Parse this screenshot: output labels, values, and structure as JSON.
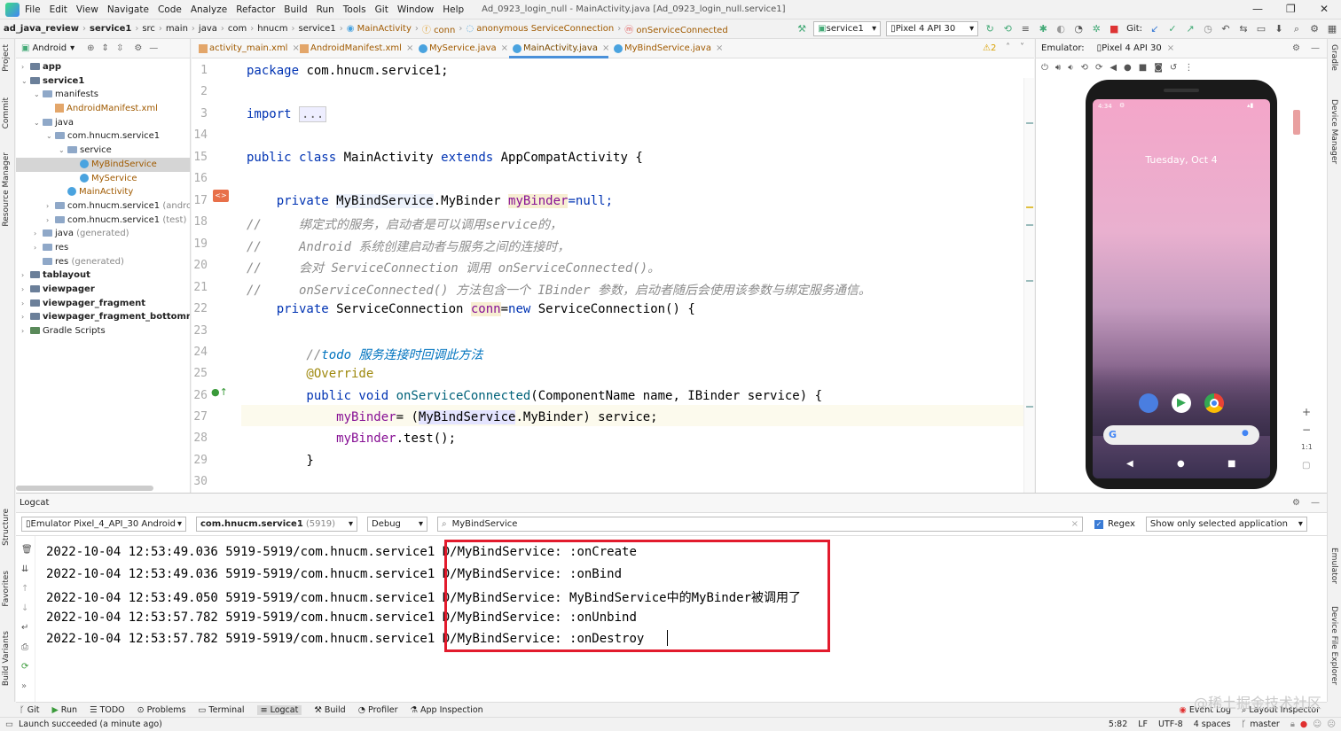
{
  "menubar": {
    "items": [
      "File",
      "Edit",
      "View",
      "Navigate",
      "Code",
      "Analyze",
      "Refactor",
      "Build",
      "Run",
      "Tools",
      "Git",
      "Window",
      "Help"
    ],
    "window_title": "Ad_0923_login_null - MainActivity.java [Ad_0923_login_null.service1]"
  },
  "navbar": {
    "crumbs": [
      "ad_java_review",
      "service1",
      "src",
      "main",
      "java",
      "com",
      "hnucm",
      "service1",
      "MainActivity",
      "conn",
      "anonymous ServiceConnection",
      "onServiceConnected"
    ],
    "run_config": "service1",
    "device": "Pixel 4 API 30",
    "git_label": "Git:"
  },
  "left_tools": [
    "Project",
    "Commit",
    "Resource Manager",
    "Structure",
    "Favorites",
    "Build Variants"
  ],
  "right_tools": [
    "Gradle",
    "Device Manager",
    "Emulator",
    "Device File Explorer"
  ],
  "project": {
    "view": "Android",
    "tree": [
      {
        "label": "app",
        "bold": true,
        "indent": 0,
        "type": "module",
        "arrow": "›"
      },
      {
        "label": "service1",
        "bold": true,
        "indent": 0,
        "type": "module",
        "arrow": "⌄"
      },
      {
        "label": "manifests",
        "indent": 1,
        "type": "folder",
        "arrow": "⌄"
      },
      {
        "label": "AndroidManifest.xml",
        "indent": 2,
        "type": "xml",
        "arrow": "",
        "color": "#a05a00"
      },
      {
        "label": "java",
        "indent": 1,
        "type": "folder",
        "arrow": "⌄"
      },
      {
        "label": "com.hnucm.service1",
        "indent": 2,
        "type": "folder",
        "arrow": "⌄"
      },
      {
        "label": "service",
        "indent": 3,
        "type": "folder",
        "arrow": "⌄"
      },
      {
        "label": "MyBindService",
        "indent": 4,
        "type": "class",
        "arrow": "",
        "selected": true,
        "color": "#a05a00"
      },
      {
        "label": "MyService",
        "indent": 4,
        "type": "class",
        "arrow": "",
        "color": "#a05a00"
      },
      {
        "label": "MainActivity",
        "indent": 3,
        "type": "class",
        "arrow": "",
        "color": "#a05a00"
      },
      {
        "label": "com.hnucm.service1",
        "suffix": " (android",
        "indent": 2,
        "type": "folder",
        "arrow": "›"
      },
      {
        "label": "com.hnucm.service1",
        "suffix": " (test)",
        "indent": 2,
        "type": "folder",
        "arrow": "›"
      },
      {
        "label": "java",
        "suffix": " (generated)",
        "indent": 1,
        "type": "folder",
        "arrow": "›"
      },
      {
        "label": "res",
        "indent": 1,
        "type": "folder",
        "arrow": "›"
      },
      {
        "label": "res",
        "suffix": " (generated)",
        "indent": 1,
        "type": "folder",
        "arrow": ""
      },
      {
        "label": "tablayout",
        "bold": true,
        "indent": 0,
        "type": "module",
        "arrow": "›"
      },
      {
        "label": "viewpager",
        "bold": true,
        "indent": 0,
        "type": "module",
        "arrow": "›"
      },
      {
        "label": "viewpager_fragment",
        "bold": true,
        "indent": 0,
        "type": "module",
        "arrow": "›"
      },
      {
        "label": "viewpager_fragment_bottomnavig",
        "bold": true,
        "indent": 0,
        "type": "module",
        "arrow": "›"
      },
      {
        "label": "Gradle Scripts",
        "indent": 0,
        "type": "gradle",
        "arrow": "›"
      }
    ]
  },
  "tabs": [
    {
      "label": "activity_main.xml",
      "type": "xml"
    },
    {
      "label": "AndroidManifest.xml",
      "type": "xml"
    },
    {
      "label": "MyService.java",
      "type": "class"
    },
    {
      "label": "MainActivity.java",
      "type": "class",
      "active": true
    },
    {
      "label": "MyBindService.java",
      "type": "class"
    }
  ],
  "editor": {
    "warnings": "⚠2",
    "line_numbers": [
      "1",
      "2",
      "3",
      "14",
      "15",
      "16",
      "17",
      "18",
      "19",
      "20",
      "21",
      "22",
      "23",
      "24",
      "25",
      "26",
      "27",
      "28",
      "29",
      "30"
    ],
    "code": {
      "l1_kw": "package",
      "l1_rest": " com.hnucm.service1;",
      "l3_kw": "import",
      "l3_fold": "...",
      "l15_a": "public class",
      "l15_b": " MainActivity ",
      "l15_c": "extends",
      "l15_d": " AppCompatActivity {",
      "l17_a": "    private ",
      "l17_b": "MyBindService",
      "l17_c": ".MyBinder ",
      "l17_d": "myBinder",
      "l17_e": "=null;",
      "l18": "//     绑定式的服务，启动者是可以调用service的，",
      "l19": "//     Android 系统创建启动者与服务之间的连接时，",
      "l20": "//     会对 ServiceConnection 调用 onServiceConnected()。",
      "l21": "//     onServiceConnected() 方法包含一个 IBinder 参数，启动者随后会使用该参数与绑定服务通信。",
      "l22_a": "    private ",
      "l22_b": "ServiceConnection ",
      "l22_c": "conn",
      "l22_d": "=",
      "l22_e": "new",
      "l22_f": " ServiceConnection() {",
      "l24_a": "        //",
      "l24_b": "todo 服务连接时回调此方法",
      "l25": "        @Override",
      "l26_a": "        public void ",
      "l26_b": "onServiceConnected",
      "l26_c": "(ComponentName name, IBinder service) {",
      "l27_a": "            ",
      "l27_b": "myBinder",
      "l27_c": "= (",
      "l27_d": "MyBindService",
      "l27_e": ".MyBinder) service;",
      "l28_a": "            ",
      "l28_b": "myBinder",
      "l28_c": ".test();",
      "l29": "        }"
    }
  },
  "emulator": {
    "label": "Emulator:",
    "device_tab": "Pixel 4 API 30",
    "time": "4:34",
    "date": "Tuesday, Oct 4",
    "zoom_ratio": "1:1"
  },
  "logcat": {
    "title": "Logcat",
    "device": "Emulator Pixel_4_API_30 Android",
    "process": "com.hnucm.service1",
    "pid": "(5919)",
    "level": "Debug",
    "filter": "MyBindService",
    "regex_label": "Regex",
    "scope": "Show only selected application",
    "lines": [
      {
        "prefix": "2022-10-04 12:53:49.036 5919-5919/com.hnucm.service1 ",
        "msg": "D/MyBindService: :onCreate"
      },
      {
        "prefix": "2022-10-04 12:53:49.036 5919-5919/com.hnucm.service1 ",
        "msg": "D/MyBindService: :onBind"
      },
      {
        "prefix": "2022-10-04 12:53:49.050 5919-5919/com.hnucm.service1 ",
        "msg": "D/MyBindService: MyBindService中的MyBinder被调用了"
      },
      {
        "prefix": "2022-10-04 12:53:57.782 5919-5919/com.hnucm.service1 ",
        "msg": "D/MyBindService: :onUnbind"
      },
      {
        "prefix": "2022-10-04 12:53:57.782 5919-5919/com.hnucm.service1 ",
        "msg": "D/MyBindService: :onDestroy"
      }
    ],
    "highlight_color": "#e21b2d"
  },
  "bottom_tabs": [
    "Git",
    "Run",
    "TODO",
    "Problems",
    "Terminal",
    "Logcat",
    "Build",
    "Profiler",
    "App Inspection"
  ],
  "bottom_right": [
    "Event Log",
    "Layout Inspector"
  ],
  "status": {
    "message": "Launch succeeded (a minute ago)",
    "position": "5:82",
    "line_sep": "LF",
    "encoding": "UTF-8",
    "indent": "4 spaces",
    "branch": "master"
  },
  "watermark": "@稀土掘金技术社区"
}
